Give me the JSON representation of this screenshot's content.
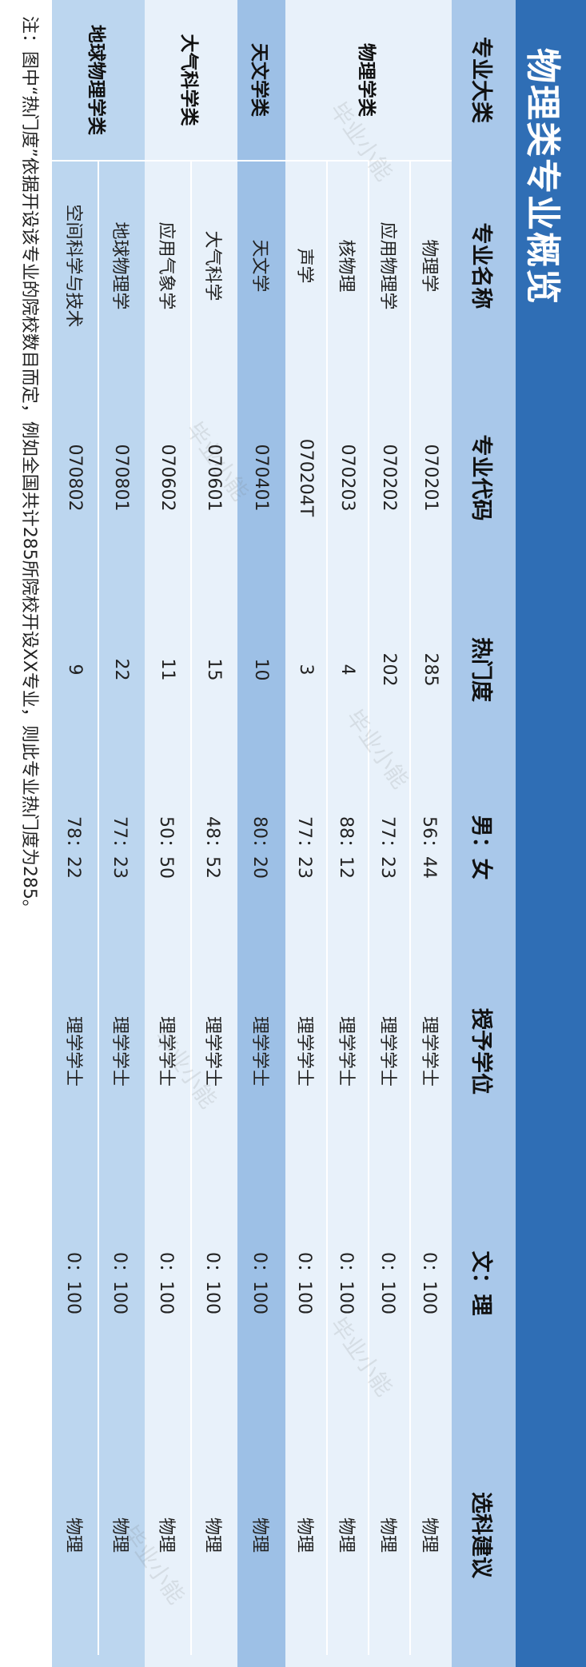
{
  "title": "物理类专业概览",
  "headers": [
    "专业大类",
    "专业名称",
    "专业代码",
    "热门度",
    "男：女",
    "授予学位",
    "文：理",
    "选科建议"
  ],
  "categories": [
    "物理学类",
    "天文学类",
    "大气科学类",
    "地球物理学类"
  ],
  "rows": [
    {
      "name": "物理学",
      "code": "070201",
      "popularity": "285",
      "ratio": "56：44",
      "degree": "理学学士",
      "arts_sci": "0：100",
      "subject": "物理"
    },
    {
      "name": "应用物理学",
      "code": "070202",
      "popularity": "202",
      "ratio": "77：23",
      "degree": "理学学士",
      "arts_sci": "0：100",
      "subject": "物理"
    },
    {
      "name": "核物理",
      "code": "070203",
      "popularity": "4",
      "ratio": "88：12",
      "degree": "理学学士",
      "arts_sci": "0：100",
      "subject": "物理"
    },
    {
      "name": "声学",
      "code": "070204T",
      "popularity": "3",
      "ratio": "77：23",
      "degree": "理学学士",
      "arts_sci": "0：100",
      "subject": "物理"
    },
    {
      "name": "天文学",
      "code": "070401",
      "popularity": "10",
      "ratio": "80：20",
      "degree": "理学学士",
      "arts_sci": "0：100",
      "subject": "物理"
    },
    {
      "name": "大气科学",
      "code": "070601",
      "popularity": "15",
      "ratio": "48：52",
      "degree": "理学学士",
      "arts_sci": "0：100",
      "subject": "物理"
    },
    {
      "name": "应用气象学",
      "code": "070602",
      "popularity": "11",
      "ratio": "50：50",
      "degree": "理学学士",
      "arts_sci": "0：100",
      "subject": "物理"
    },
    {
      "name": "地球物理学",
      "code": "070801",
      "popularity": "22",
      "ratio": "77：23",
      "degree": "理学学士",
      "arts_sci": "0：100",
      "subject": "物理"
    },
    {
      "name": "空间科学与技术",
      "code": "070802",
      "popularity": "9",
      "ratio": "78：22",
      "degree": "理学学士",
      "arts_sci": "0：100",
      "subject": "物理"
    }
  ],
  "footnote": "注：图中“热门度”依据开设该专业的院校数目而定，例如全国共计285所院校开设XX专业，则此专业热门度为285。",
  "watermark": "毕业小能",
  "colors": {
    "title_bar": "#2f6eb5",
    "header_band": "#a9c8ea",
    "light_band": "#e8f1fa",
    "mid_band": "#bcd6ef",
    "dark_band": "#9dc0e6"
  }
}
